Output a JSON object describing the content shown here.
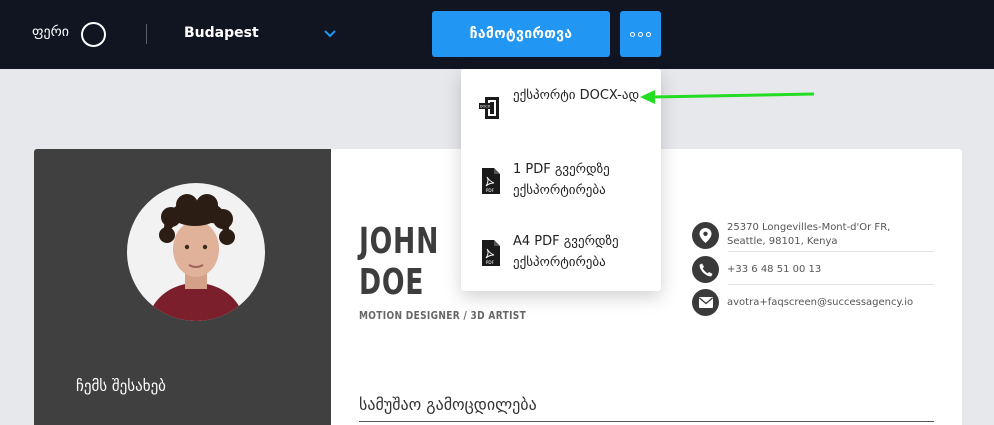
{
  "topbar": {
    "color_label": "ფერი",
    "template_name": "Budapest",
    "download_label": "ჩამოტვირთვა"
  },
  "dropdown": {
    "items": [
      {
        "label": "ექსპორტი DOCX-ად",
        "icon": "docx-file-icon",
        "icon_text": "DOCX"
      },
      {
        "label": "1 PDF გვერდზე ექსპორტირება",
        "icon": "pdf-file-icon",
        "icon_text": "PDF"
      },
      {
        "label": "A4 PDF გვერდზე ექსპორტირება",
        "icon": "pdf-file-icon",
        "icon_text": "PDF"
      }
    ]
  },
  "resume": {
    "first_name": "JOHN",
    "last_name": "DOE",
    "title": "MOTION DESIGNER / 3D ARTIST",
    "about_heading": "ჩემს შესახებ",
    "work_heading": "სამუშაო გამოცდილება",
    "contacts": [
      {
        "icon": "location-pin-icon",
        "lines": [
          "25370 Longevilles-Mont-d'Or FR,",
          "Seattle, 98101, Kenya"
        ]
      },
      {
        "icon": "phone-icon",
        "lines": [
          "+33 6 48 51 00 13"
        ]
      },
      {
        "icon": "envelope-icon",
        "lines": [
          "avotra+faqscreen@successagency.io"
        ]
      }
    ]
  },
  "colors": {
    "topbar_bg": "#111522",
    "accent_blue": "#2196f3",
    "sidebar_bg": "#404040",
    "page_bg": "#e7e8ec",
    "annotation_arrow": "#22dd22"
  }
}
